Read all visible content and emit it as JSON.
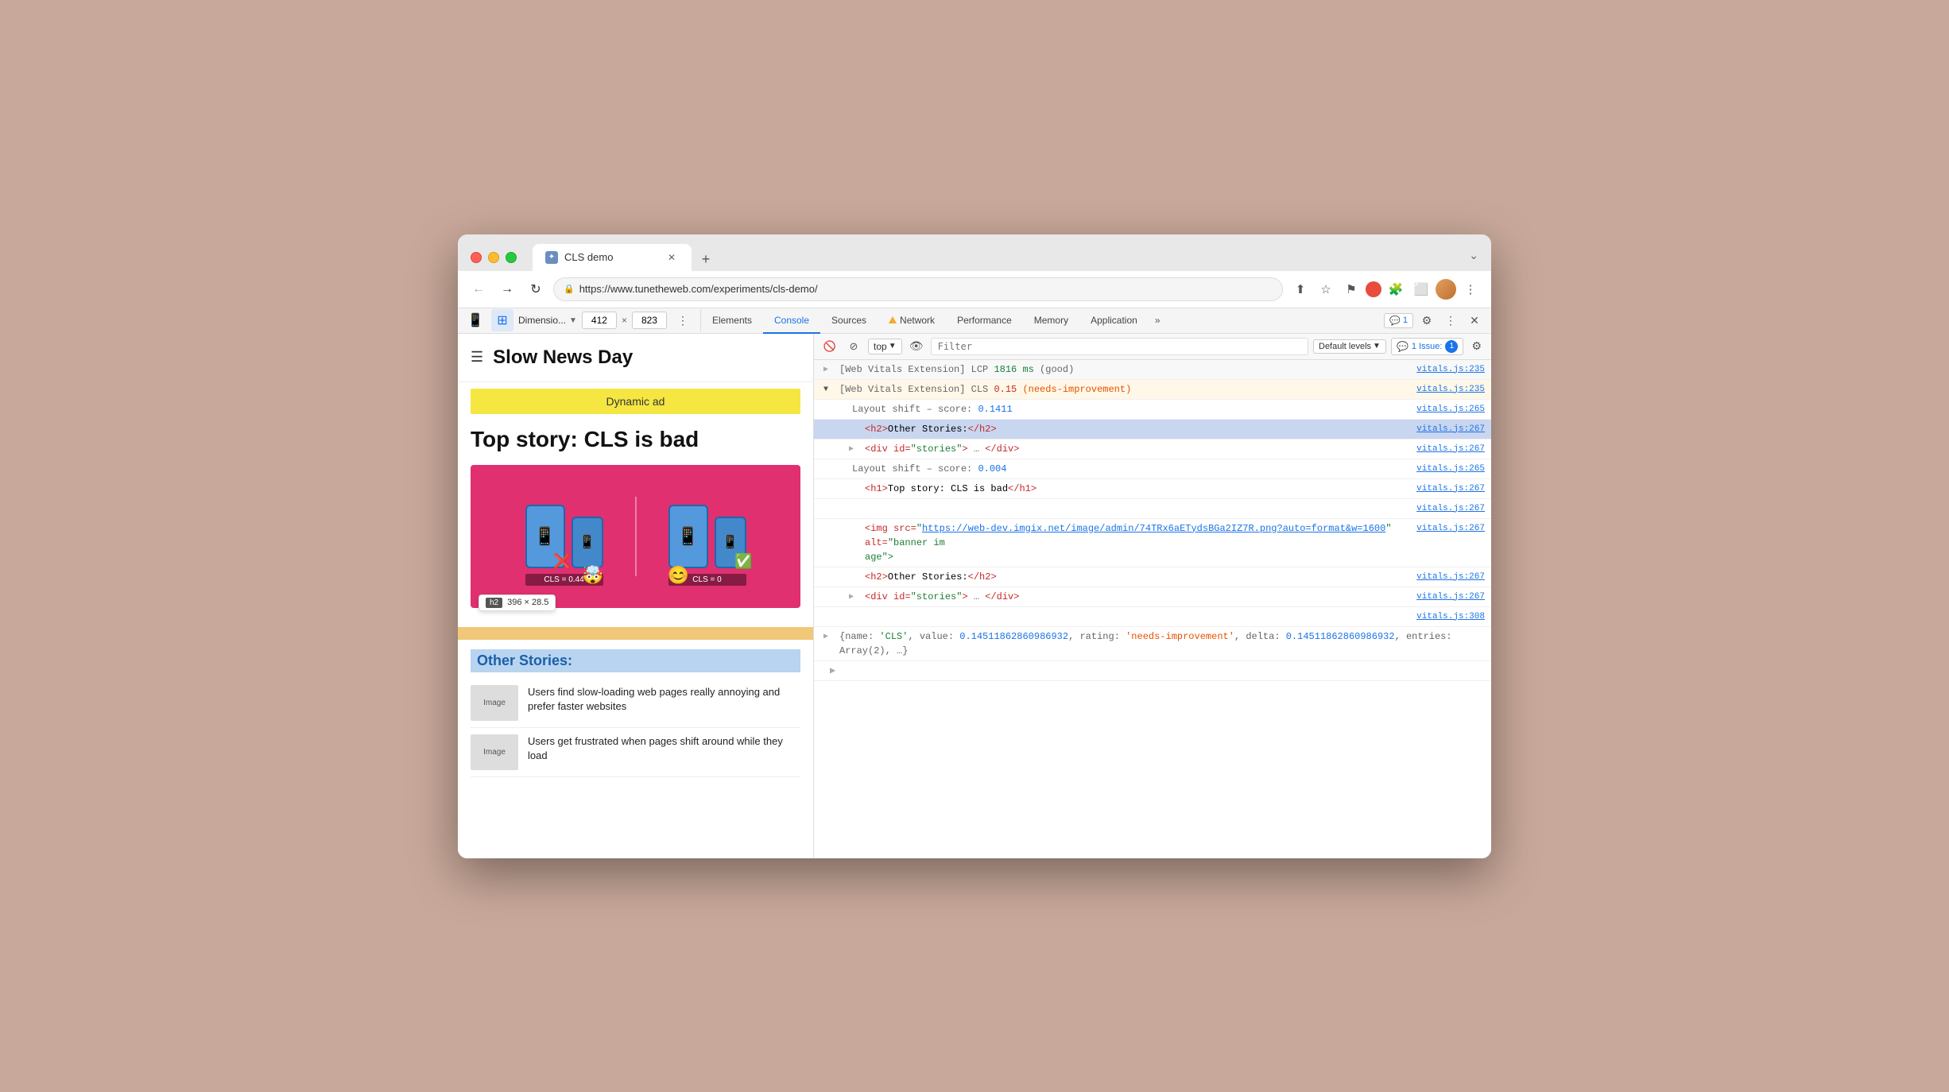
{
  "browser": {
    "tab": {
      "title": "CLS demo",
      "icon": "✦"
    },
    "new_tab_icon": "+",
    "chevron": "⌄",
    "nav": {
      "back": "←",
      "forward": "→",
      "refresh": "↻",
      "url": "https://www.tunetheweb.com/experiments/cls-demo/",
      "share": "⬆",
      "bookmark": "☆",
      "flag": "⚑",
      "extensions": "🧩",
      "layout": "⬜",
      "more": "⋮"
    }
  },
  "devtools": {
    "tabs": [
      "Elements",
      "Console",
      "Sources",
      "Network",
      "Performance",
      "Memory",
      "Application"
    ],
    "active_tab": "Console",
    "badge_label": "1",
    "settings_icon": "⚙",
    "more_icon": "⋮",
    "close_icon": "✕",
    "device": {
      "label": "Dimensio...",
      "width": "412",
      "height": "823"
    },
    "console_toolbar": {
      "clear": "🚫",
      "stop": "⊘",
      "top_label": "top",
      "eye": "👁",
      "filter_placeholder": "Filter",
      "default_levels": "Default levels",
      "issues_label": "1 Issue:",
      "issues_count": "1",
      "gear": "⚙"
    }
  },
  "page": {
    "header": {
      "hamburger": "☰",
      "title": "Slow News Day"
    },
    "ad": "Dynamic ad",
    "story_title": "Top story: CLS is bad",
    "image_caption_left": "CLS = 0.44",
    "image_caption_right": "CLS = 0",
    "h2_tooltip": {
      "badge": "h2",
      "size": "396 × 28.5"
    },
    "other_stories_heading": "Other Stories:",
    "story_items": [
      {
        "thumb": "Image",
        "text": "Users find slow-loading web pages really annoying and prefer faster websites"
      },
      {
        "thumb": "Image",
        "text": "Users get frustrated when pages shift around while they load"
      }
    ]
  },
  "console": {
    "lines": [
      {
        "id": "lcp",
        "type": "lcp",
        "expand": false,
        "text_prefix": "[Web Vitals Extension] LCP ",
        "value": "1816 ms",
        "value_class": "val-good",
        "text_suffix": " (good)",
        "source": "vitals.js:235"
      },
      {
        "id": "cls",
        "type": "cls",
        "expand": true,
        "text_prefix": "[Web Vitals Extension] CLS ",
        "value": "0.15",
        "value_class": "val-bad",
        "text_suffix": " (needs-improvement)",
        "source": "vitals.js:235"
      },
      {
        "id": "layout1",
        "type": "sub",
        "text": "Layout shift – score: ",
        "value": "0.1411",
        "value_class": "val-neutral",
        "source": "vitals.js:265"
      },
      {
        "id": "h2",
        "type": "sub-sub-hl",
        "text": "<h2>Other Stories:</h2>",
        "source": "vitals.js:267"
      },
      {
        "id": "div-stories",
        "type": "sub-sub",
        "expand": false,
        "text": "<div id=\"stories\">",
        "text2": "</div>",
        "source": "vitals.js:267"
      },
      {
        "id": "layout2",
        "type": "sub",
        "text": "Layout shift – score: ",
        "value": "0.004",
        "value_class": "val-neutral",
        "source": "vitals.js:265"
      },
      {
        "id": "h1",
        "type": "sub-sub",
        "text": "<h1>Top story: CLS is bad</h1>",
        "source": "vitals.js:267"
      },
      {
        "id": "empty",
        "type": "empty",
        "source": "vitals.js:267"
      },
      {
        "id": "img",
        "type": "img-sub",
        "text_before": "<img src=\"",
        "link": "https://web-dev.imgix.net/image/admin/74TRx6aETydsBGa2IZ7R.png?auto=format&w=1600",
        "text_after": "\" alt=\"banner im",
        "text_wrap": "age\">",
        "source": "vitals.js:267"
      },
      {
        "id": "h2-2",
        "type": "sub-sub",
        "text": "<h2>Other Stories:</h2>",
        "source": "vitals.js:267"
      },
      {
        "id": "div-stories-2",
        "type": "sub-sub",
        "expand": false,
        "text": "<div id=\"stories\">",
        "text2": "</div>",
        "source": "vitals.js:267"
      },
      {
        "id": "vitals308",
        "type": "empty-src",
        "source": "vitals.js:308"
      },
      {
        "id": "obj",
        "type": "obj",
        "expand": false,
        "text": "{name: 'CLS', value: ",
        "value": "0.14511862860986932",
        "value_class": "val-neutral",
        "text2": ", rating: '",
        "value2": "needs-improvement",
        "value2_class": "val-bad",
        "text3": "', delta: ",
        "value3": "0.14511862860986932",
        "value3_class": "val-neutral",
        "text4": ", entries: Array(2), …}",
        "source": ""
      },
      {
        "id": "bottom-arrow",
        "type": "expand-only",
        "expand": false
      }
    ]
  }
}
